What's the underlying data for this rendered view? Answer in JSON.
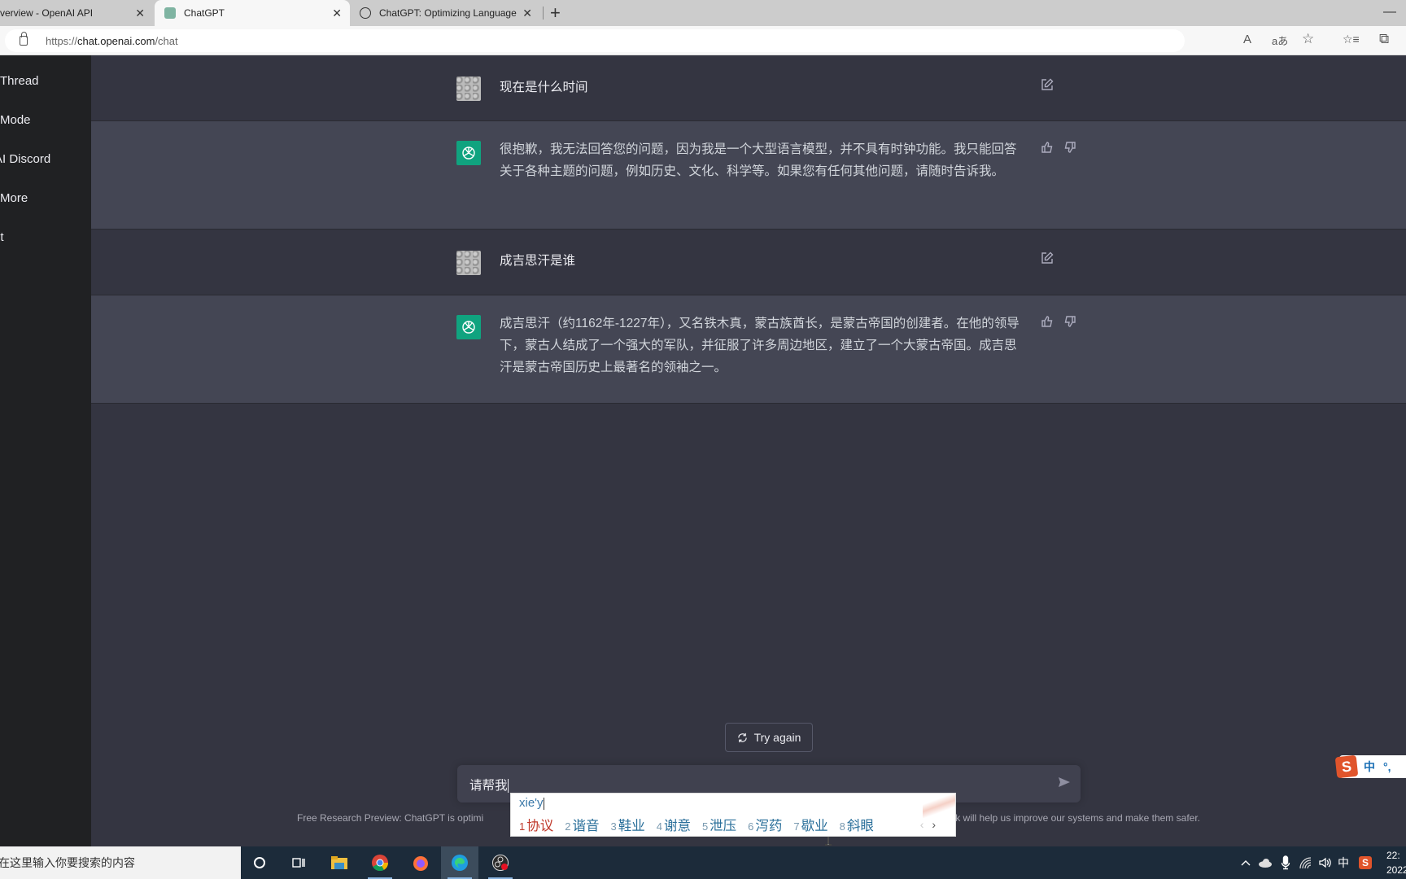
{
  "browser": {
    "tabs": [
      {
        "title": "verview - OpenAI API",
        "close": "✕"
      },
      {
        "title": "ChatGPT",
        "close": "✕"
      },
      {
        "title": "ChatGPT: Optimizing Language M",
        "close": "✕"
      }
    ],
    "new_tab": "+",
    "minimize": "—",
    "url_prefix": "https://",
    "url_host": "chat.openai.com",
    "url_path": "/chat",
    "toolbar_icons": [
      "read-aloud-icon",
      "translate-icon",
      "add-favorite-icon",
      "favorites-icon",
      "collections-icon"
    ],
    "read_aloud": "A",
    "translate": "aあ",
    "add_fav": "☆",
    "favorites": "☆≡",
    "collections": "⧉"
  },
  "sidebar": {
    "items": [
      {
        "label": "Thread"
      },
      {
        "label": "Mode"
      },
      {
        "label": "AI Discord"
      },
      {
        "label": "More"
      },
      {
        "label": "ut"
      }
    ]
  },
  "conversation": {
    "messages": [
      {
        "role": "user",
        "text": "现在是什么时间"
      },
      {
        "role": "assistant",
        "text": "很抱歉，我无法回答您的问题，因为我是一个大型语言模型，并不具有时钟功能。我只能回答关于各种主题的问题，例如历史、文化、科学等。如果您有任何其他问题，请随时告诉我。"
      },
      {
        "role": "user",
        "text": "成吉思汗是谁"
      },
      {
        "role": "assistant",
        "text": "成吉思汗（约1162年-1227年），又名铁木真，蒙古族酋长，是蒙古帝国的创建者。在他的领导下，蒙古人结成了一个强大的军队，并征服了许多周边地区，建立了一个大蒙古帝国。成吉思汗是蒙古帝国历史上最著名的领袖之一。"
      }
    ]
  },
  "try_again": {
    "label": "Try again"
  },
  "composer": {
    "value": "请帮我"
  },
  "footer": {
    "left": "Free Research Preview: ChatGPT is optimi",
    "right": "k will help us improve our systems and make them safer."
  },
  "ime": {
    "composition": "xie'y",
    "candidates": [
      {
        "num": "1",
        "text": "协议"
      },
      {
        "num": "2",
        "text": "谐音"
      },
      {
        "num": "3",
        "text": "鞋业"
      },
      {
        "num": "4",
        "text": "谢意"
      },
      {
        "num": "5",
        "text": "泄压"
      },
      {
        "num": "6",
        "text": "泻药"
      },
      {
        "num": "7",
        "text": "歇业"
      },
      {
        "num": "8",
        "text": "斜眼"
      }
    ],
    "prev": "‹",
    "next": "›"
  },
  "sogou_bar": {
    "logo": "S",
    "mode": "中",
    "punct": "°,"
  },
  "taskbar": {
    "search_placeholder": "在这里输入你要搜索的内容",
    "tray_lang": "中",
    "clock_time": "22:",
    "clock_date": "2022"
  },
  "colors": {
    "sidebar_bg": "#202123",
    "main_bg": "#343541",
    "bot_row_bg": "#444654",
    "bot_avatar": "#10a37f",
    "input_bg": "#40414f"
  }
}
